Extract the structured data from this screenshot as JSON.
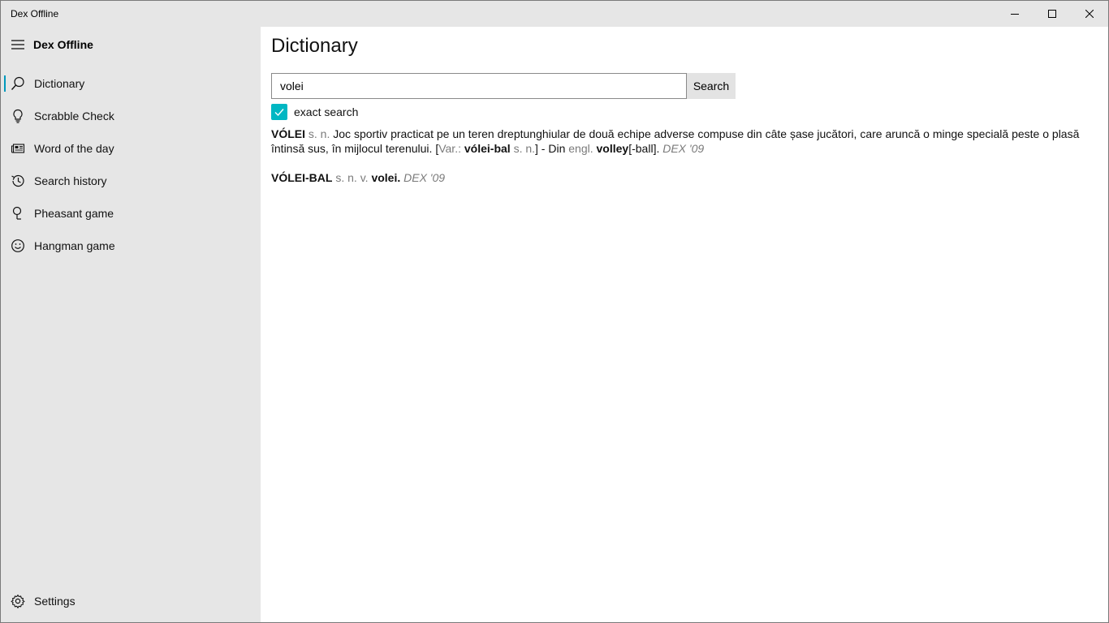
{
  "window": {
    "title": "Dex Offline"
  },
  "sidebar": {
    "app_title": "Dex Offline",
    "items": [
      {
        "label": "Dictionary",
        "icon": "search-icon",
        "selected": true
      },
      {
        "label": "Scrabble Check",
        "icon": "lightbulb-icon"
      },
      {
        "label": "Word of the day",
        "icon": "newspaper-icon"
      },
      {
        "label": "Search history",
        "icon": "history-icon"
      },
      {
        "label": "Pheasant game",
        "icon": "pin-icon"
      },
      {
        "label": "Hangman game",
        "icon": "smiley-icon"
      }
    ],
    "settings_label": "Settings"
  },
  "main": {
    "page_title": "Dictionary",
    "search": {
      "value": "volei",
      "button_label": "Search"
    },
    "exact_search": {
      "label": "exact search",
      "checked": true
    },
    "definitions": [
      {
        "headword": "VÓLEI",
        "pos": "s. n.",
        "text_1": "Joc sportiv practicat pe un teren dreptunghiular de două echipe adverse compuse din câte șase jucători, care aruncă o minge specială peste o plasă întinsă sus, în mijlocul terenului. [",
        "var_label": "Var.:",
        "variant": "vólei-bal",
        "variant_pos": "s. n.",
        "text_2": "] - Din",
        "lang": "engl.",
        "etym": "volley",
        "etym_rest": "[-ball].",
        "source": "DEX '09"
      },
      {
        "headword": "VÓLEI-BAL",
        "pos": "s. n. v.",
        "ref": "volei.",
        "source": "DEX '09"
      }
    ]
  },
  "colors": {
    "accent": "#00b7c3",
    "selection_bar": "#0099bc",
    "sidebar_bg": "#e6e6e6"
  }
}
